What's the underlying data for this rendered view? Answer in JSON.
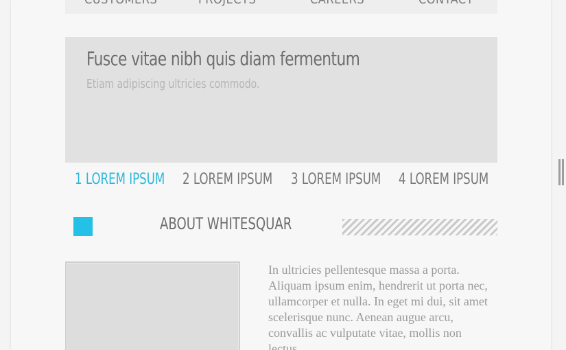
{
  "nav": {
    "items": [
      "CUSTOMERS",
      "PROJECTS",
      "CAREERS",
      "CONTACT"
    ]
  },
  "hero": {
    "title": "Fusce vitae nibh quis diam fermentum",
    "subtitle": "Etiam adipiscing ultricies commodo."
  },
  "tabs": [
    {
      "label": "1 LOREM IPSUM",
      "active": true
    },
    {
      "label": "2 LOREM IPSUM",
      "active": false
    },
    {
      "label": "3 LOREM IPSUM",
      "active": false
    },
    {
      "label": "4 LOREM IPSUM",
      "active": false
    }
  ],
  "about": {
    "title": "ABOUT WHITESQUAR",
    "body": "In ultricies pellentesque massa a porta. Aliquam ipsum enim, hendrerit ut porta nec, ullamcorper et nulla. In eget mi dui, sit amet scelerisque nunc. Aenean augue arcu, convallis ac vulputate vitae, mollis non lectus."
  },
  "colors": {
    "accent": "#24c1e6",
    "active_tab": "#29b8dd"
  }
}
